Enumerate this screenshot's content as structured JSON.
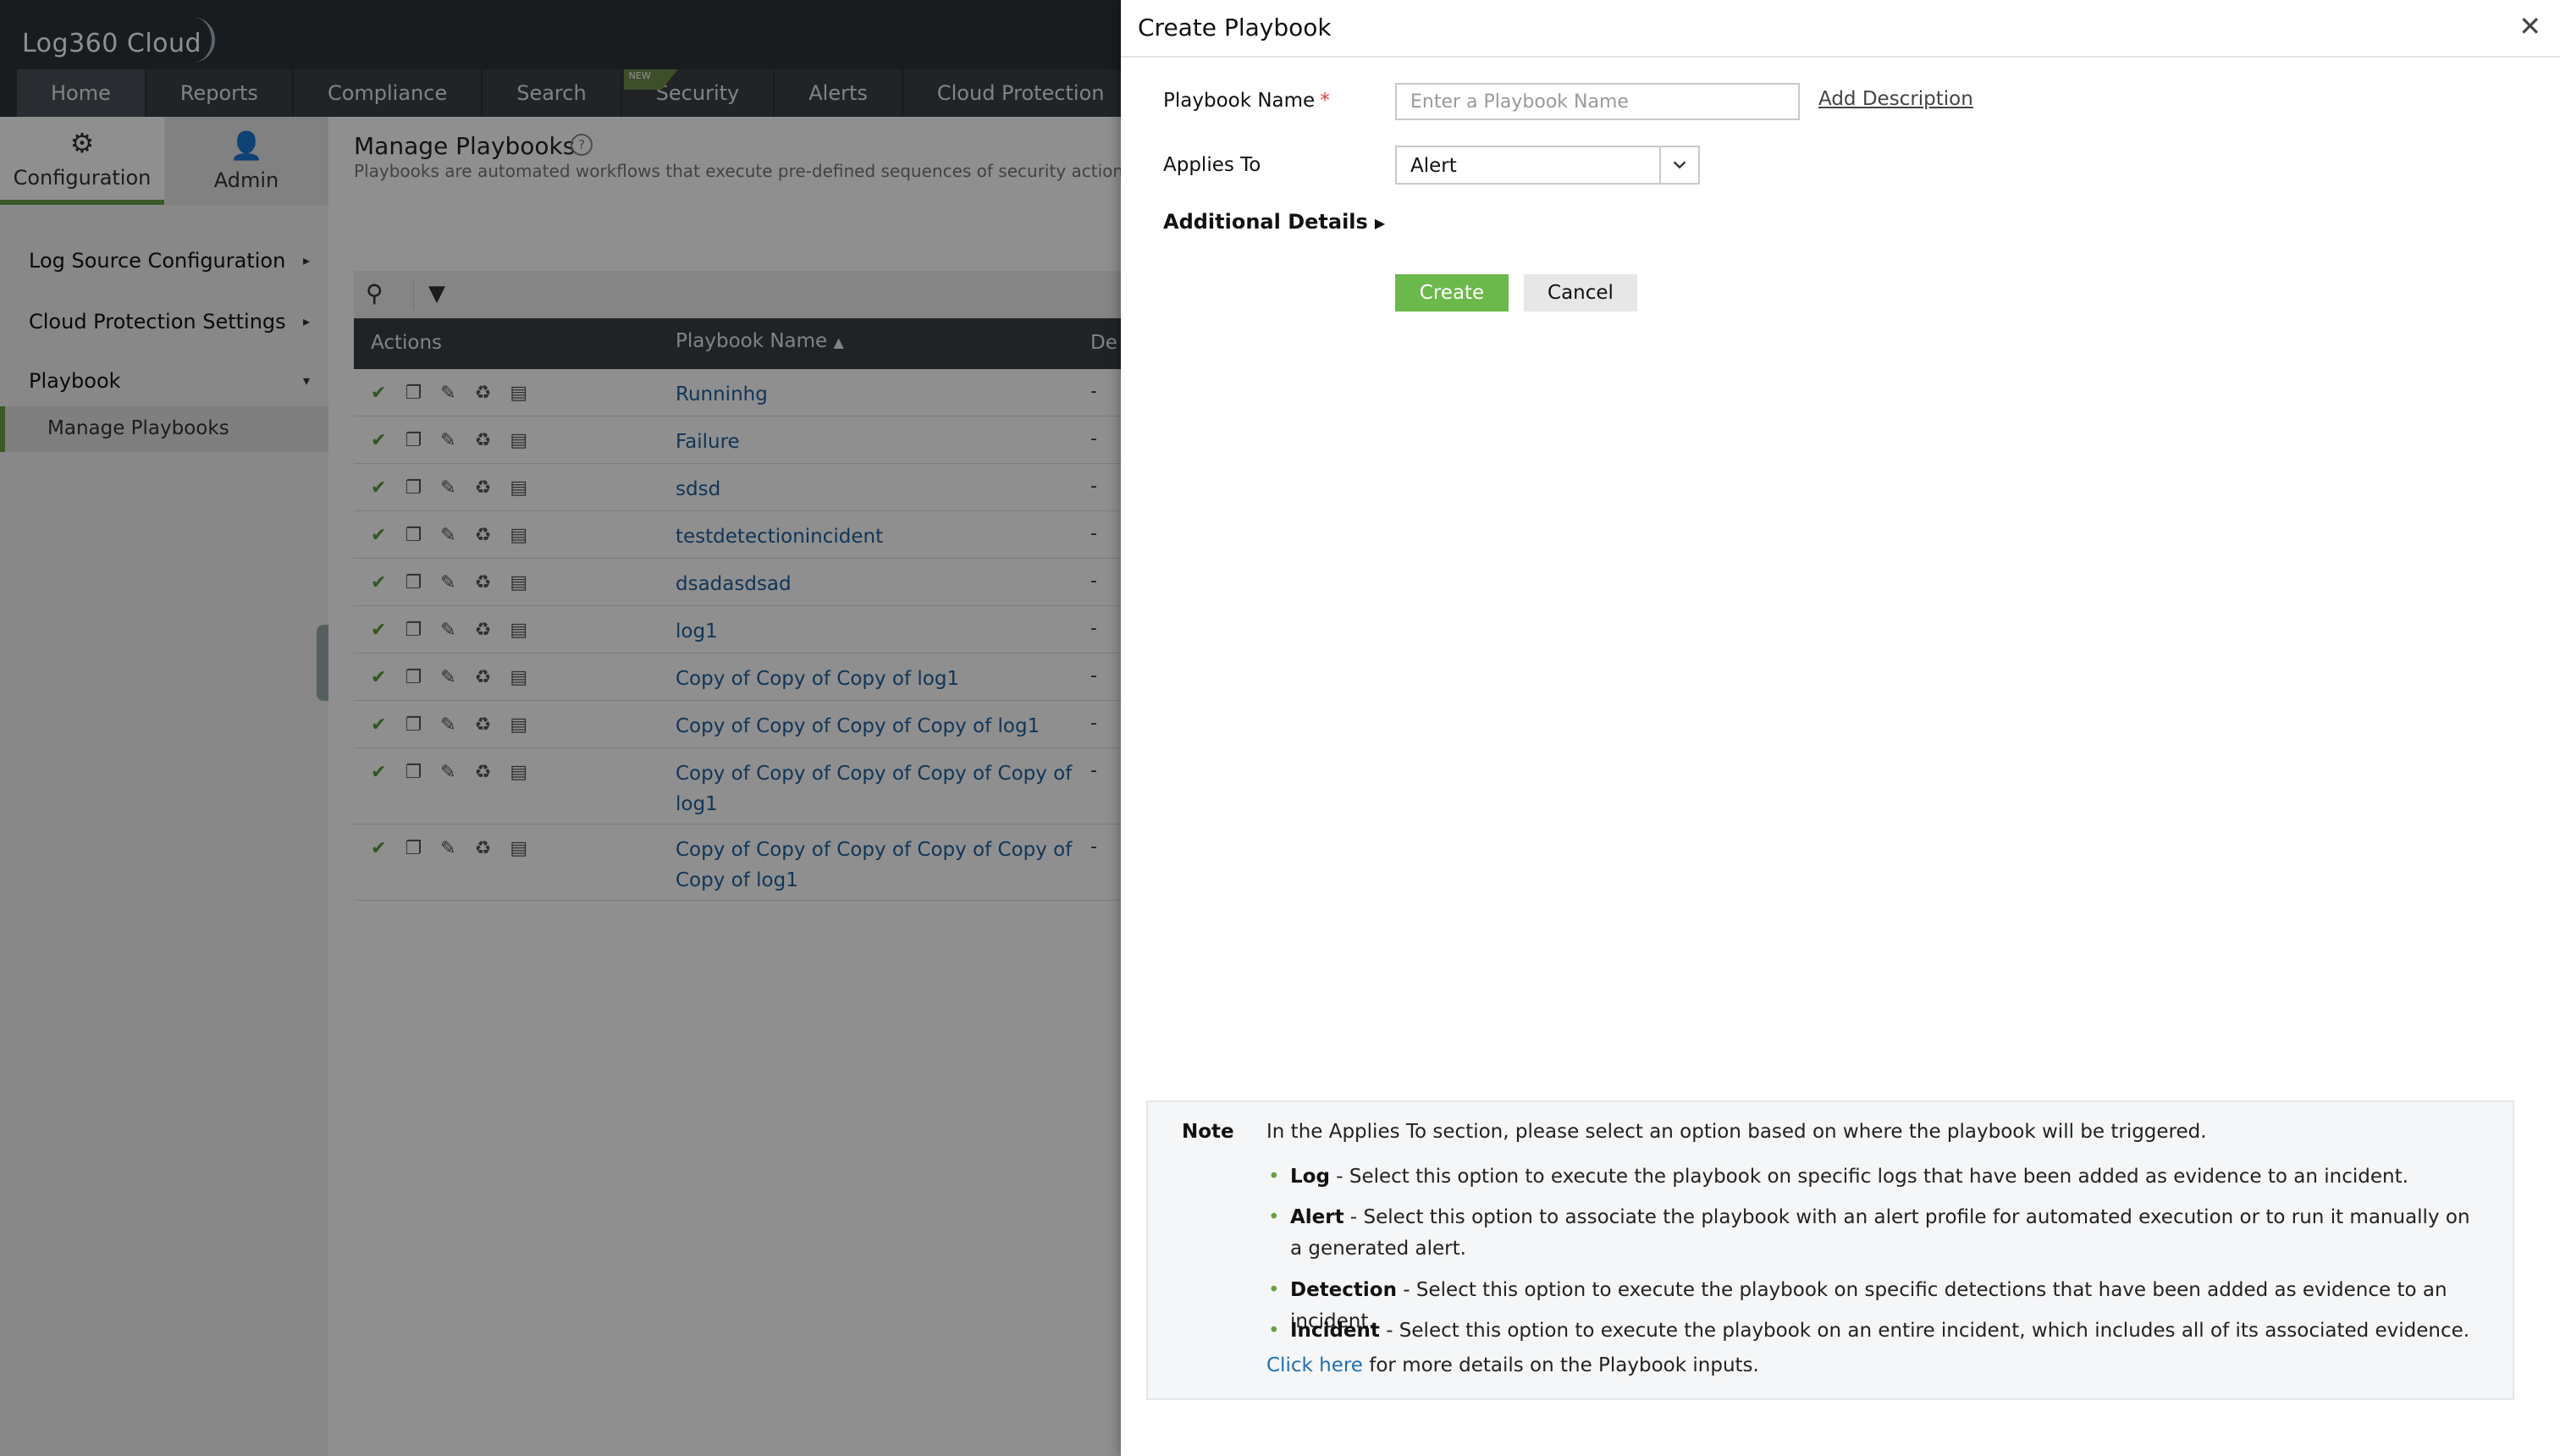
{
  "app": {
    "logo_text": "Log360 Cloud",
    "nav_tabs": [
      "Home",
      "Reports",
      "Compliance",
      "Search",
      "Security",
      "Alerts",
      "Cloud Protection"
    ],
    "new_badge": "NEW"
  },
  "sidebar": {
    "tabs": [
      {
        "label": "Configuration",
        "icon": "gear-icon"
      },
      {
        "label": "Admin",
        "icon": "user-icon"
      }
    ],
    "items": [
      "Log Source Configuration",
      "Cloud Protection Settings",
      "Playbook"
    ],
    "subitem": "Manage Playbooks"
  },
  "main": {
    "title": "Manage Playbooks",
    "description": "Playbooks are automated workflows that execute pre-defined sequences of security actions",
    "columns": [
      "Actions",
      "Playbook Name",
      "De"
    ],
    "rows": [
      {
        "name": "Runninhg",
        "desc": "-"
      },
      {
        "name": "Failure",
        "desc": "-"
      },
      {
        "name": "sdsd",
        "desc": "-"
      },
      {
        "name": "testdetectionincident",
        "desc": "-"
      },
      {
        "name": "dsadasdsad",
        "desc": "-"
      },
      {
        "name": "log1",
        "desc": "-"
      },
      {
        "name": "Copy of Copy of Copy of log1",
        "desc": "-"
      },
      {
        "name": "Copy of Copy of Copy of Copy of log1",
        "desc": "-"
      },
      {
        "name": "Copy of Copy of Copy of Copy of Copy of log1",
        "desc": "-"
      },
      {
        "name": "Copy of Copy of Copy of Copy of Copy of Copy of log1",
        "desc": "-"
      }
    ]
  },
  "panel": {
    "title": "Create Playbook",
    "name_label": "Playbook Name",
    "name_required": "*",
    "name_placeholder": "Enter a Playbook Name",
    "add_description": "Add Description",
    "applies_label": "Applies To",
    "applies_value": "Alert",
    "additional_details": "Additional Details",
    "create": "Create",
    "cancel": "Cancel",
    "note": {
      "label": "Note",
      "intro": "In the Applies To section, please select an option based on where the playbook will be triggered.",
      "items": [
        {
          "term": "Log",
          "text": " - Select this option to execute the playbook on specific logs that have been added as evidence to an incident."
        },
        {
          "term": "Alert",
          "text": " - Select this option to associate the playbook with an alert profile for automated execution or to run it manually on a generated alert."
        },
        {
          "term": "Detection",
          "text": " - Select this option to execute the playbook on specific detections that have been added as evidence to an incident."
        },
        {
          "term": "Incident",
          "text": " - Select this option to execute the playbook on an entire incident, which includes all of its associated evidence."
        }
      ],
      "link": "Click here",
      "footer": " for more details on the Playbook inputs."
    }
  },
  "colors": {
    "accent": "#6cb94b",
    "link": "#1f6fb5",
    "topbar": "#2e3337"
  }
}
